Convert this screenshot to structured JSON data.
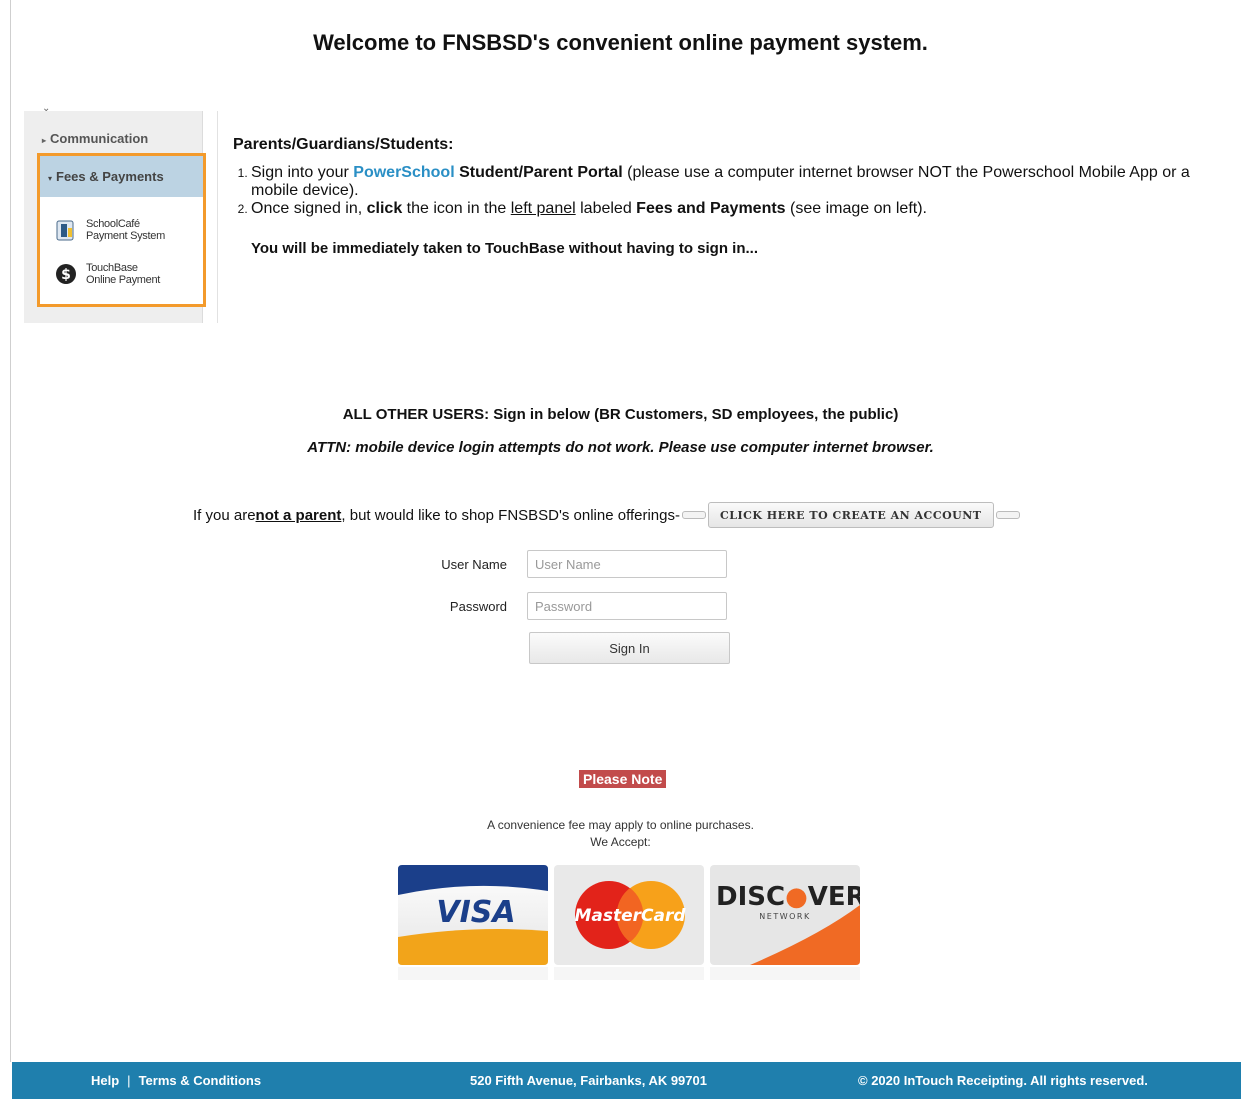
{
  "headline": "Welcome to FNSBSD's convenient online payment system.",
  "panel": {
    "communication": "Communication",
    "fees_payments": "Fees & Payments",
    "schoolcafe_line1": "SchoolCafé",
    "schoolcafe_line2": "Payment System",
    "touchbase_line1": "TouchBase",
    "touchbase_line2": "Online Payment"
  },
  "instructions": {
    "title": "Parents/Guardians/Students:",
    "step1_pre": "Sign into your ",
    "step1_link": "PowerSchool",
    "step1_bold": " Student/Parent Portal",
    "step1_post": " (please use a computer internet browser NOT the Powerschool Mobile App or a mobile device).",
    "step2_pre": "Once signed in, ",
    "step2_click": "click",
    "step2_mid": " the icon in the ",
    "step2_left_panel": "left panel",
    "step2_mid2": " labeled ",
    "step2_bold": "Fees and Payments",
    "step2_post": " (see image on left).",
    "note": "You will be immediately taken to TouchBase without having to sign in..."
  },
  "other_users": "ALL OTHER USERS:  Sign in below (BR Customers, SD employees, the public)",
  "attn": "ATTN: mobile device login attempts do not work. Please use computer internet browser.",
  "create": {
    "pre": "If you are ",
    "not_parent": "not a parent",
    "post": ", but would like to shop FNSBSD's online offerings-",
    "button": "CLICK HERE TO CREATE AN ACCOUNT"
  },
  "login": {
    "username_label": "User Name",
    "username_placeholder": "User Name",
    "password_label": "Password",
    "password_placeholder": "Password",
    "signin": "Sign In"
  },
  "please_note": "Please Note",
  "fee_line1": "A convenience fee may apply to online purchases.",
  "fee_line2": "We Accept:",
  "cards": {
    "visa": "VISA",
    "mastercard": "MasterCard",
    "discover_pre": "DISC",
    "discover_post": "VER",
    "discover_network": "NETWORK"
  },
  "footer": {
    "help": "Help",
    "separator": "|",
    "terms": "Terms & Conditions",
    "address": "520 Fifth Avenue, Fairbanks, AK 99701",
    "copyright": "© 2020 InTouch Receipting. All rights reserved."
  },
  "colors": {
    "accent_orange": "#f39a2b",
    "footer_blue": "#1f7fad",
    "powerschool_blue": "#2a8fc5",
    "note_red": "#c24b4b"
  }
}
